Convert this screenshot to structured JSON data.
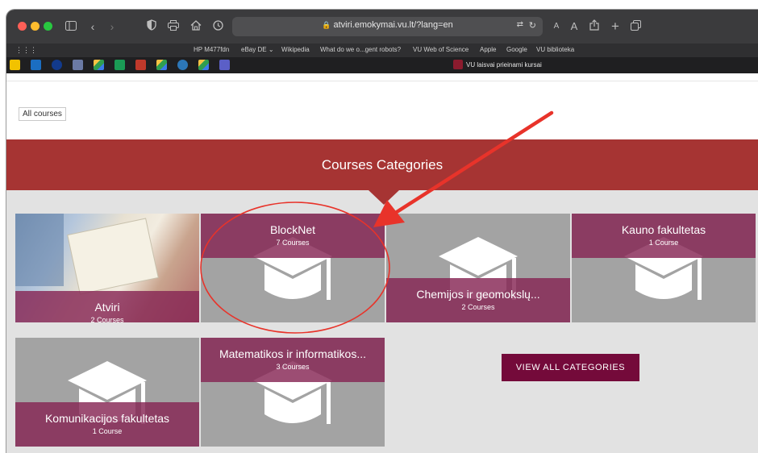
{
  "browser": {
    "url": "atviri.emokymai.vu.lt/?lang=en",
    "text_size_small": "A",
    "text_size_large": "A",
    "favorites": [
      "HP M477fdn",
      "eBay DE",
      "Wikipedia",
      "What do we o...gent robots?",
      "VU Web of Science",
      "Apple",
      "Google",
      "VU biblioteka"
    ],
    "tab_title": "VU laisvai prieinami kursai"
  },
  "page": {
    "all_courses_label": "All courses",
    "section_title": "Courses Categories",
    "view_all_label": "VIEW ALL CATEGORIES",
    "categories": [
      {
        "title": "Atviri",
        "count": "2 Courses"
      },
      {
        "title": "BlockNet",
        "count": "7 Courses"
      },
      {
        "title": "Chemijos ir geomokslų...",
        "count": "2 Courses"
      },
      {
        "title": "Kauno fakultetas",
        "count": "1 Course"
      },
      {
        "title": "Komunikacijos fakultetas",
        "count": "1 Course"
      },
      {
        "title": "Matematikos ir informatikos...",
        "count": "3 Courses"
      }
    ]
  },
  "colors": {
    "band": "#a63433",
    "overlay": "#862654",
    "button": "#740a3a",
    "annotation": "#e8332a"
  }
}
